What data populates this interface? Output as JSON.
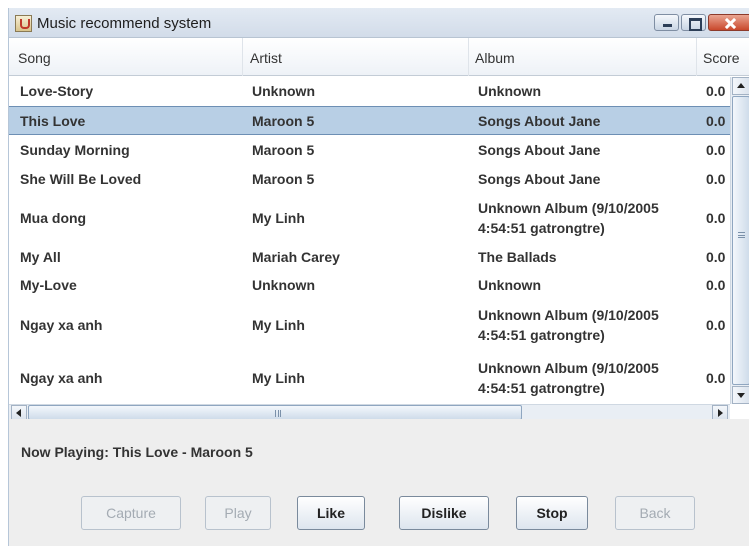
{
  "window": {
    "title": "Music recommend system"
  },
  "table": {
    "columns": [
      "Song",
      "Artist",
      "Album",
      "Score"
    ],
    "rows": [
      {
        "song": "Love-Story",
        "artist": "Unknown",
        "album": "Unknown",
        "score": "0.0",
        "selected": false
      },
      {
        "song": "This Love",
        "artist": "Maroon 5",
        "album": "Songs About Jane",
        "score": "0.0",
        "selected": true
      },
      {
        "song": "Sunday Morning",
        "artist": "Maroon 5",
        "album": "Songs About Jane",
        "score": "0.0",
        "selected": false
      },
      {
        "song": "She Will Be Loved",
        "artist": "Maroon 5",
        "album": "Songs About Jane",
        "score": "0.0",
        "selected": false
      },
      {
        "song": "Mua dong",
        "artist": "My Linh",
        "album": "Unknown Album (9/10/2005 4:54:51 gatrongtre)",
        "score": "0.0",
        "selected": false
      },
      {
        "song": "My All",
        "artist": "Mariah Carey",
        "album": "The Ballads",
        "score": "0.0",
        "selected": false
      },
      {
        "song": "My-Love",
        "artist": "Unknown",
        "album": "Unknown",
        "score": "0.0",
        "selected": false
      },
      {
        "song": "Ngay xa anh",
        "artist": "My Linh",
        "album": "Unknown Album (9/10/2005 4:54:51 gatrongtre)",
        "score": "0.0",
        "selected": false
      },
      {
        "song": "Ngay xa anh",
        "artist": "My Linh",
        "album": "Unknown Album (9/10/2005 4:54:51 gatrongtre)",
        "score": "0.0",
        "selected": false
      }
    ]
  },
  "status": {
    "now_playing": "Now Playing: This Love - Maroon 5"
  },
  "buttons": {
    "capture": "Capture",
    "play": "Play",
    "like": "Like",
    "dislike": "Dislike",
    "stop": "Stop",
    "back": "Back"
  }
}
